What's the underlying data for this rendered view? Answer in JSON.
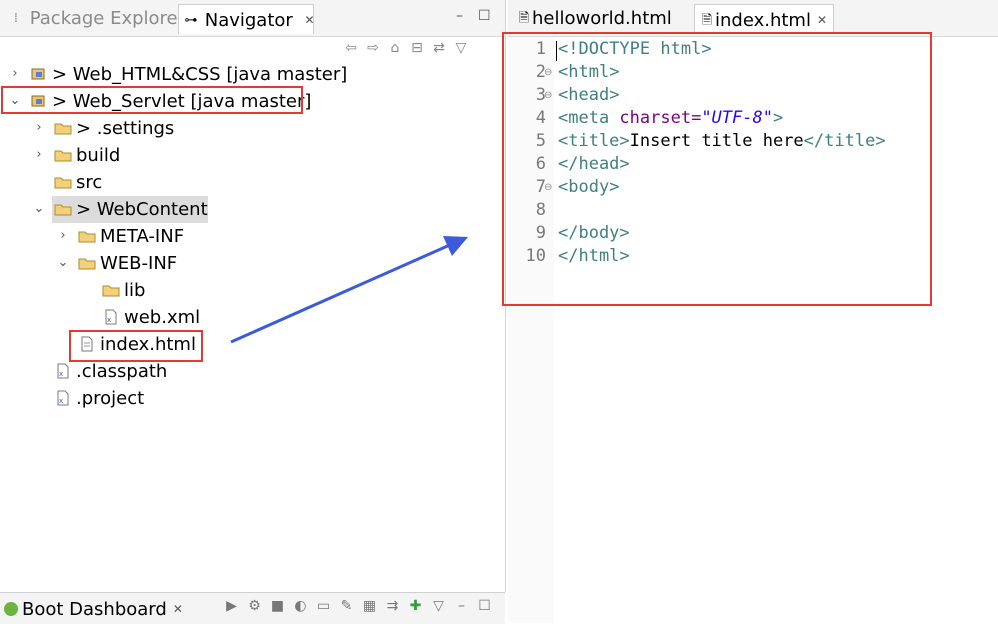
{
  "left_tabs": {
    "package_explorer": "Package Explorer",
    "navigator": "Navigator"
  },
  "tree": [
    {
      "label": "> Web_HTML&CSS [java master]",
      "icon": "project-icon",
      "expanded": false
    },
    {
      "label": "> Web_Servlet [java master]",
      "icon": "project-icon",
      "expanded": true,
      "highlighted": true
    },
    {
      "label": "> .settings",
      "icon": "folder-icon",
      "expanded": false
    },
    {
      "label": "build",
      "icon": "folder-icon",
      "expanded": false
    },
    {
      "label": "src",
      "icon": "folder-icon"
    },
    {
      "label": "> WebContent",
      "icon": "folder-icon",
      "expanded": true,
      "selected": true
    },
    {
      "label": "META-INF",
      "icon": "folder-icon",
      "expanded": false
    },
    {
      "label": "WEB-INF",
      "icon": "folder-icon",
      "expanded": true
    },
    {
      "label": "lib",
      "icon": "folder-icon"
    },
    {
      "label": "web.xml",
      "icon": "xml-file-icon"
    },
    {
      "label": "index.html",
      "icon": "html-file-icon",
      "highlighted": true
    },
    {
      "label": ".classpath",
      "icon": "xml-file-icon"
    },
    {
      "label": ".project",
      "icon": "xml-file-icon"
    }
  ],
  "bottom": {
    "boot_dashboard": "Boot Dashboard"
  },
  "editor_tabs": {
    "helloworld": "helloworld.html",
    "index": "index.html"
  },
  "editor": {
    "line_numbers": [
      "1",
      "2",
      "3",
      "4",
      "5",
      "6",
      "7",
      "8",
      "9",
      "10"
    ],
    "lines": [
      "<!DOCTYPE html>",
      "<html>",
      "<head>",
      "<meta charset=\"UTF-8\">",
      "<title>Insert title here</title>",
      "</head>",
      "<body>",
      "",
      "</body>",
      "</html>"
    ]
  },
  "colors": {
    "highlight_red": "#e53935",
    "arrow_blue": "#3b5bdb",
    "tag_teal": "#3f7f7f",
    "attr_purple": "#7f007f",
    "value_blue": "#2a00ff"
  }
}
